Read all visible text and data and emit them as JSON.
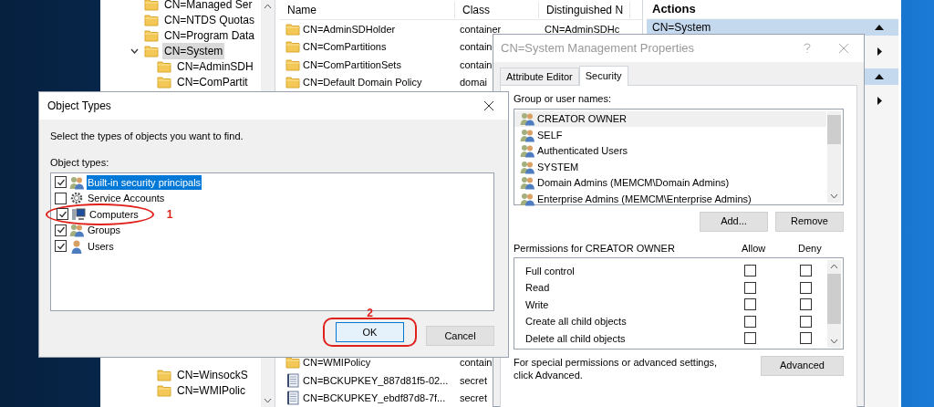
{
  "tree": {
    "items": [
      {
        "label": "CN=Managed Ser"
      },
      {
        "label": "CN=NTDS Quotas"
      },
      {
        "label": "CN=Program Data"
      },
      {
        "label": "CN=System",
        "selected": true,
        "expanded": true,
        "children": [
          {
            "label": "CN=AdminSDH"
          },
          {
            "label": "CN=ComPartit"
          }
        ]
      }
    ]
  },
  "tree_lower": {
    "items": [
      {
        "label": "CN=WinsockS"
      },
      {
        "label": "CN=WMIPolic"
      }
    ]
  },
  "list": {
    "columns": [
      "Name",
      "Class",
      "Distinguished N"
    ],
    "rows_top": [
      {
        "kind": "folder",
        "name": "CN=AdminSDHolder",
        "class": "container",
        "dn": "CN=AdminSDHc"
      },
      {
        "kind": "folder",
        "name": "CN=ComPartitions",
        "class": "contain"
      },
      {
        "kind": "folder",
        "name": "CN=ComPartitionSets",
        "class": "contain"
      },
      {
        "kind": "folder",
        "name": "CN=Default Domain Policy",
        "class": "domai"
      }
    ],
    "rows_bottom": [
      {
        "kind": "folder",
        "name": "CN=WMIPolicy",
        "class": "contain"
      },
      {
        "kind": "secret",
        "name": "CN=BCKUPKEY_887d81f5-02...",
        "class": "secret"
      },
      {
        "kind": "secret",
        "name": "CN=BCKUPKEY_ebdf87d8-7f...",
        "class": "secret"
      }
    ]
  },
  "actions": {
    "title": "Actions",
    "section": {
      "label": "CN=System"
    }
  },
  "properties": {
    "title": "CN=System Management Properties",
    "tabs": [
      {
        "label": "Attribute Editor",
        "selected": false
      },
      {
        "label": "Security",
        "selected": true
      }
    ],
    "group_label": "Group or user names:",
    "principals": [
      {
        "name": "CREATOR OWNER",
        "selected": true
      },
      {
        "name": "SELF",
        "selected": false
      },
      {
        "name": "Authenticated Users",
        "selected": false
      },
      {
        "name": "SYSTEM",
        "selected": false
      },
      {
        "name": "Domain Admins (MEMCM\\Domain Admins)",
        "selected": false
      },
      {
        "name": "Enterprise Admins (MEMCM\\Enterprise Admins)",
        "selected": false
      }
    ],
    "buttons": [
      "Add...",
      "Remove"
    ],
    "permissions_label": "Permissions for CREATOR OWNER",
    "permission_columns": [
      "Allow",
      "Deny"
    ],
    "permissions": [
      {
        "name": "Full control",
        "allow": false,
        "deny": false
      },
      {
        "name": "Read",
        "allow": false,
        "deny": false
      },
      {
        "name": "Write",
        "allow": false,
        "deny": false
      },
      {
        "name": "Create all child objects",
        "allow": false,
        "deny": false
      },
      {
        "name": "Delete all child objects",
        "allow": false,
        "deny": false
      }
    ],
    "note": "For special permissions or advanced settings, click Advanced.",
    "advanced_button": "Advanced"
  },
  "object_types": {
    "title": "Object Types",
    "instruction": "Select the types of objects you want to find.",
    "list_label": "Object types:",
    "types": [
      {
        "kind": "group",
        "label": "Built-in security principals",
        "checked": true,
        "selected": true,
        "circled": false
      },
      {
        "kind": "gear",
        "label": "Service Accounts",
        "checked": false,
        "selected": false,
        "circled": false
      },
      {
        "kind": "computer",
        "label": "Computers",
        "checked": true,
        "selected": false,
        "circled": true,
        "annotation": "1"
      },
      {
        "kind": "group",
        "label": "Groups",
        "checked": true,
        "selected": false,
        "circled": false
      },
      {
        "kind": "user",
        "label": "Users",
        "checked": true,
        "selected": false,
        "circled": false
      }
    ],
    "buttons": [
      {
        "label": "OK",
        "default": true,
        "circled": true,
        "annotation": "2"
      },
      {
        "label": "Cancel",
        "default": false,
        "circled": false
      }
    ]
  }
}
